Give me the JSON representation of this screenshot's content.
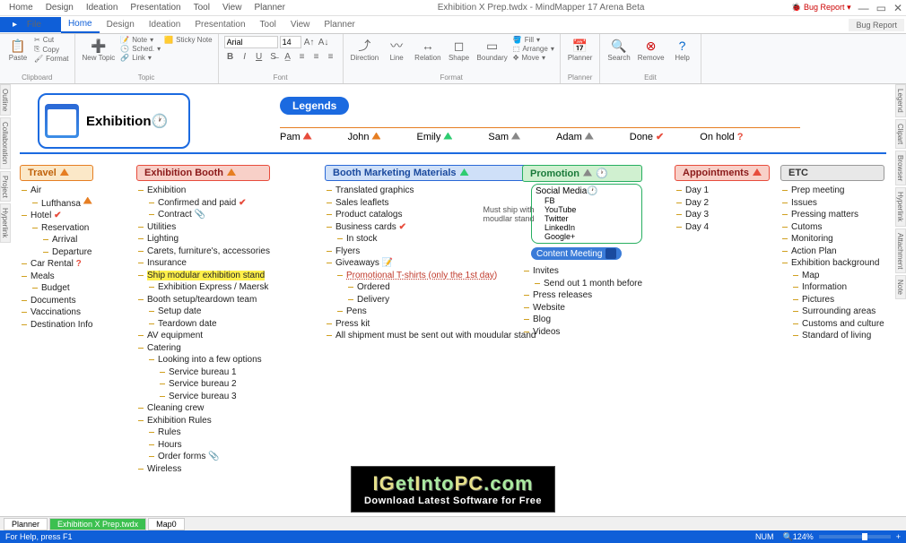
{
  "titlebar": {
    "menus": [
      "Home",
      "Design",
      "Ideation",
      "Presentation",
      "Tool",
      "View",
      "Planner"
    ],
    "title": "Exhibition X Prep.twdx - MindMapper 17 Arena Beta",
    "bug": "Bug Report"
  },
  "ribbon_tabs": {
    "file": "File"
  },
  "ribbon": {
    "clipboard": {
      "paste": "Paste",
      "cut": "Cut",
      "copy": "Copy",
      "format": "Format",
      "label": "Clipboard"
    },
    "topic": {
      "new_topic": "New Topic",
      "note": "Note",
      "sched": "Sched.",
      "link": "Link",
      "sticky": "Sticky Note",
      "label": "Topic"
    },
    "font": {
      "name": "Arial",
      "size": "14",
      "label": "Font"
    },
    "format": {
      "direction": "Direction",
      "line": "Line",
      "relation": "Relation",
      "shape": "Shape",
      "boundary": "Boundary",
      "fill": "Fill",
      "arrange": "Arrange",
      "move": "Move",
      "label": "Format"
    },
    "planner": {
      "planner": "Planner",
      "label": "Planner"
    },
    "edit": {
      "search": "Search",
      "remove": "Remove",
      "help": "Help",
      "label": "Edit"
    }
  },
  "side_left": [
    "Outline",
    "Collaboration",
    "Project",
    "Hyperlink"
  ],
  "side_right": [
    "Legend",
    "Clipart",
    "Browser",
    "Hyperlink",
    "Attachment",
    "Note"
  ],
  "root": {
    "name": "Exhibition"
  },
  "legends": {
    "title": "Legends",
    "items": [
      "Pam",
      "John",
      "Emily",
      "Sam",
      "Adam",
      "Done",
      "On hold"
    ]
  },
  "branches": {
    "travel": {
      "title": "Travel",
      "items": [
        {
          "t": "Air",
          "c": [
            {
              "t": "Lufthansa",
              "i": "person"
            }
          ]
        },
        {
          "t": "Hotel",
          "i": "check",
          "c": [
            {
              "t": "Reservation",
              "c": [
                {
                  "t": "Arrival"
                },
                {
                  "t": "Departure"
                }
              ]
            }
          ]
        },
        {
          "t": "Car Rental",
          "i": "q"
        },
        {
          "t": "Meals",
          "c": [
            {
              "t": "Budget"
            }
          ]
        },
        {
          "t": "Documents"
        },
        {
          "t": "Vaccinations"
        },
        {
          "t": "Destination Info"
        }
      ]
    },
    "booth": {
      "title": "Exhibition Booth",
      "items": [
        {
          "t": "Exhibition",
          "c": [
            {
              "t": "Confirmed and paid",
              "i": "check"
            },
            {
              "t": "Contract",
              "i": "clip"
            }
          ]
        },
        {
          "t": "Utilities"
        },
        {
          "t": "Lighting"
        },
        {
          "t": "Carets, furniture's, accessories"
        },
        {
          "t": "Insurance"
        },
        {
          "t": "Ship modular exhibition stand",
          "hl": true,
          "c": [
            {
              "t": "Exhibition Express / Maersk"
            }
          ]
        },
        {
          "t": "Booth setup/teardown team",
          "c": [
            {
              "t": "Setup date"
            },
            {
              "t": "Teardown date"
            }
          ]
        },
        {
          "t": "AV equipment"
        },
        {
          "t": "Catering",
          "c": [
            {
              "t": "Looking into a few options",
              "c": [
                {
                  "t": "Service bureau 1"
                },
                {
                  "t": "Service bureau 2"
                },
                {
                  "t": "Service bureau 3"
                }
              ]
            }
          ]
        },
        {
          "t": "Cleaning crew"
        },
        {
          "t": "Exhibition Rules",
          "c": [
            {
              "t": "Rules"
            },
            {
              "t": "Hours"
            },
            {
              "t": "Order forms",
              "i": "clip"
            }
          ]
        },
        {
          "t": "Wireless"
        }
      ]
    },
    "marketing": {
      "title": "Booth Marketing Materials",
      "note": "Must ship with moudlar stand",
      "items": [
        {
          "t": "Translated graphics"
        },
        {
          "t": "Sales leaflets"
        },
        {
          "t": "Product catalogs"
        },
        {
          "t": "Business cards",
          "i": "check",
          "c": [
            {
              "t": "In stock"
            }
          ]
        },
        {
          "t": "Flyers"
        },
        {
          "t": "Giveaways",
          "i": "note",
          "c": [
            {
              "t": "Promotional T-shirts (only the 1st day)",
              "red": true,
              "c": [
                {
                  "t": "Ordered"
                },
                {
                  "t": "Delivery"
                }
              ]
            },
            {
              "t": "Pens"
            }
          ]
        },
        {
          "t": "Press kit"
        },
        {
          "t": "All shipment must be sent out with moudular stand"
        }
      ]
    },
    "promotion": {
      "title": "Promotion",
      "social": {
        "title": "Social Media",
        "items": [
          "FB",
          "YouTube",
          "Twitter",
          "LinkedIn",
          "Google+"
        ]
      },
      "content": "Content Meeting",
      "items": [
        {
          "t": "Invites",
          "c": [
            {
              "t": "Send out 1 month before"
            }
          ]
        },
        {
          "t": "Press releases"
        },
        {
          "t": "Website"
        },
        {
          "t": "Blog"
        },
        {
          "t": "Videos"
        }
      ]
    },
    "appointments": {
      "title": "Appointments",
      "items": [
        {
          "t": "Day 1"
        },
        {
          "t": "Day 2"
        },
        {
          "t": "Day 3"
        },
        {
          "t": "Day 4"
        }
      ]
    },
    "etc": {
      "title": "ETC",
      "items": [
        {
          "t": "Prep meeting"
        },
        {
          "t": "Issues"
        },
        {
          "t": "Pressing matters"
        },
        {
          "t": "Cutoms"
        },
        {
          "t": "Monitoring"
        },
        {
          "t": "Action Plan"
        },
        {
          "t": "Exhibition background",
          "c": [
            {
              "t": "Map"
            },
            {
              "t": "Information"
            },
            {
              "t": "Pictures"
            },
            {
              "t": "Surrounding areas"
            },
            {
              "t": "Customs and culture"
            },
            {
              "t": "Standard of living"
            }
          ]
        }
      ]
    }
  },
  "watermark": {
    "l1a": "IG",
    "l1b": "et",
    "l1c": "I",
    "l1d": "nto",
    "l1e": "PC",
    "l1f": ".com",
    "l2": "Download Latest Software for Free"
  },
  "bottom_tabs": [
    "Planner",
    "Exhibition X Prep.twdx",
    "Map0"
  ],
  "status": {
    "help": "For Help, press F1",
    "num": "NUM",
    "zoom": "124%"
  }
}
